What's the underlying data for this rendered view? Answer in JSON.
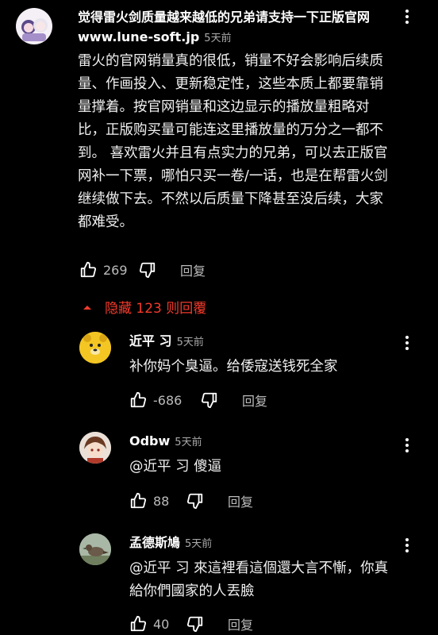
{
  "main_comment": {
    "author": "觉得雷火剑质量越来越低的兄弟请支持一下正版官网www.lune-soft.jp",
    "time": "5天前",
    "text": "雷火的官网销量真的很低，销量不好会影响后续质量、作画投入、更新稳定性，这些本质上都要靠销量撑着。按官网销量和这边显示的播放量粗略对比，正版购买量可能连这里播放量的万分之一都不到。 喜欢雷火并且有点实力的兄弟，可以去正版官网补一下票，哪怕只买一卷/一话，也是在帮雷火剑继续做下去。不然以后质量下降甚至没后续，大家都难受。",
    "likes": "269",
    "reply_label": "回复"
  },
  "replies_toggle": {
    "label": "隐藏 123 则回覆"
  },
  "replies": [
    {
      "author": "近平 习",
      "time": "5天前",
      "text": "补你妈个臭逼。给倭寇送钱死全家",
      "likes": "-686",
      "reply_label": "回复"
    },
    {
      "author": "Odbw",
      "time": "5天前",
      "text": "@近平 习 傻逼",
      "likes": "88",
      "reply_label": "回复"
    },
    {
      "author": "孟德斯鳩",
      "time": "5天前",
      "text": "@近平 习 來這裡看這個還大言不慚，你真給你們國家的人丟臉",
      "likes": "40",
      "reply_label": "回复"
    }
  ],
  "colors": {
    "accent_red": "#f23a2c",
    "background": "#000000"
  },
  "icons": [
    "avatar",
    "more-vert-icon",
    "thumbs-up-icon",
    "thumbs-down-icon",
    "chevron-up-icon"
  ]
}
